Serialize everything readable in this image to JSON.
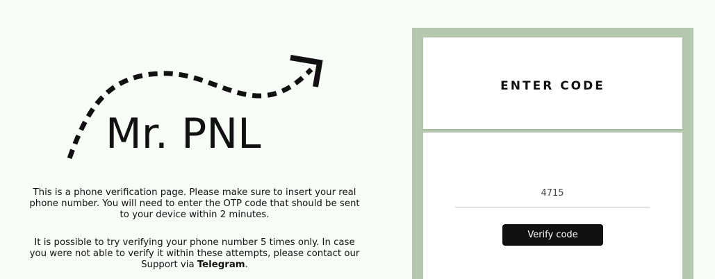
{
  "brand": {
    "logo_text": "Mr. PNL"
  },
  "intro": {
    "paragraph_1": "This is a phone verification page. Please make sure to insert your real phone number. You will need to enter the OTP code that should be sent to your device within 2 minutes.",
    "paragraph_2_prefix": "It is possible to try verifying your phone number 5 times only. In case you were not able to verify it within these attempts, please contact our Support via ",
    "telegram_link": "Telegram",
    "paragraph_2_suffix": "."
  },
  "verify_card": {
    "title": "ENTER CODE",
    "code_value": "4715",
    "verify_button_label": "Verify code"
  },
  "colors": {
    "background": "#f7fcf7",
    "frame": "#b3c8ad",
    "button": "#111111"
  },
  "icons": {
    "arrow": "dotted-curved-arrow-icon"
  }
}
